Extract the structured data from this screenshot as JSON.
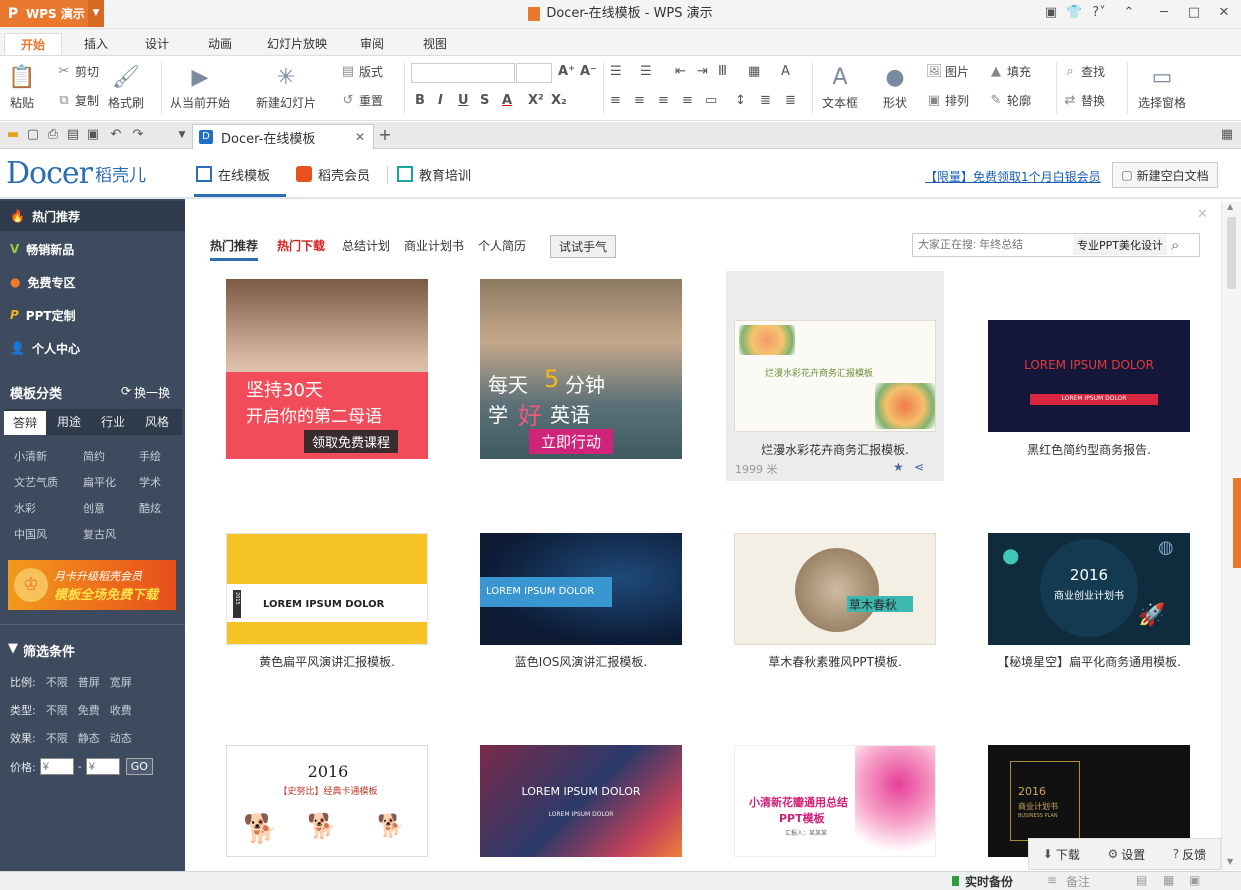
{
  "app": {
    "name": "WPS 演示",
    "window_title": "Docer-在线模板 - WPS 演示"
  },
  "ribbon_tabs": [
    "开始",
    "插入",
    "设计",
    "动画",
    "幻灯片放映",
    "审阅",
    "视图"
  ],
  "toolbar": {
    "paste": "粘贴",
    "cut": "剪切",
    "copy": "复制",
    "format_painter": "格式刷",
    "from_current": "从当前开始",
    "new_slide": "新建幻灯片",
    "layout": "版式",
    "reset": "重置",
    "textbox": "文本框",
    "shape": "形状",
    "picture": "图片",
    "arrange": "排列",
    "fill": "填充",
    "outline": "轮廓",
    "find": "查找",
    "replace": "替换",
    "selection_pane": "选择窗格"
  },
  "doc_tab": {
    "title": "Docer-在线模板"
  },
  "docer_header": {
    "logo": "Docer",
    "logo_cn": "稻壳儿",
    "nav": [
      "在线模板",
      "稻壳会员",
      "教育培训"
    ],
    "promo_link": "【限量】免费领取1个月白银会员",
    "new_blank_button": "新建空白文档"
  },
  "sidebar": {
    "nav": [
      "热门推荐",
      "畅销新品",
      "免费专区",
      "PPT定制",
      "个人中心"
    ],
    "category_title": "模板分类",
    "refresh": "换一换",
    "category_tabs": [
      "答辩",
      "用途",
      "行业",
      "风格"
    ],
    "categories": [
      "小清新",
      "简约",
      "手绘",
      "文艺气质",
      "扁平化",
      "学术",
      "水彩",
      "创意",
      "酷炫",
      "中国风",
      "复古风"
    ],
    "banner_line1": "月卡升级稻壳会员",
    "banner_line2": "模板全场免费下载",
    "filter_title": "筛选条件",
    "filters": [
      {
        "label": "比例:",
        "options": [
          "不限",
          "普屏",
          "宽屏"
        ]
      },
      {
        "label": "类型:",
        "options": [
          "不限",
          "免费",
          "收费"
        ]
      },
      {
        "label": "效果:",
        "options": [
          "不限",
          "静态",
          "动态"
        ]
      }
    ],
    "price_label": "价格:",
    "price_placeholder": "¥",
    "price_dash": "-",
    "go": "GO"
  },
  "main": {
    "tabs": [
      "热门推荐",
      "热门下载",
      "总结计划",
      "商业计划书",
      "个人简历"
    ],
    "try_button": "试试手气",
    "search_placeholder": "大家正在搜: 年终总结",
    "search_chip": "专业PPT美化设计",
    "cards": [
      {
        "caption": "",
        "thumb_text": [
          "坚持30天",
          "开启你的第二母语",
          "领取免费课程"
        ]
      },
      {
        "caption": "",
        "thumb_text": [
          "每天",
          "5",
          "分钟",
          "学",
          "好",
          "英语",
          "立即行动"
        ]
      },
      {
        "caption": "烂漫水彩花卉商务汇报模板.",
        "thumb_text": [
          "烂漫水彩花卉商务汇报模板"
        ],
        "meta": "1999 米"
      },
      {
        "caption": "黑红色简约型商务报告.",
        "thumb_text": [
          "LOREM IPSUM DOLOR",
          "LOREM IPSUM DOLOR"
        ]
      },
      {
        "caption": "黄色扁平风演讲汇报模板.",
        "thumb_text": [
          "LOREM IPSUM DOLOR",
          "2015"
        ]
      },
      {
        "caption": "蓝色IOS风演讲汇报模板.",
        "thumb_text": [
          "LOREM IPSUM DOLOR"
        ]
      },
      {
        "caption": "草木春秋素雅风PPT模板.",
        "thumb_text": [
          "草木春秋"
        ]
      },
      {
        "caption": "【秘境星空】扁平化商务通用模板.",
        "thumb_text": [
          "2016",
          "商业创业计划书"
        ]
      },
      {
        "caption": "",
        "thumb_text": [
          "2016",
          "【史努比】经典卡通模板"
        ]
      },
      {
        "caption": "",
        "thumb_text": [
          "LOREM IPSUM DOLOR",
          "LOREM IPSUM DOLOR"
        ]
      },
      {
        "caption": "",
        "thumb_text": [
          "小清新花瓣通用总结",
          "PPT模板",
          "汇报人：某某某"
        ]
      },
      {
        "caption": "",
        "thumb_text": [
          "2016",
          "商业计划书",
          "BUSINESS PLAN"
        ]
      }
    ]
  },
  "float_bar": [
    "下载",
    "设置",
    "反馈"
  ],
  "status": {
    "backup": "实时备份",
    "note": "备注"
  },
  "colors": {
    "accent": "#e8782e",
    "sidebar": "#3e4b5e",
    "link": "#1a5fb4",
    "hot": "#d42020"
  }
}
